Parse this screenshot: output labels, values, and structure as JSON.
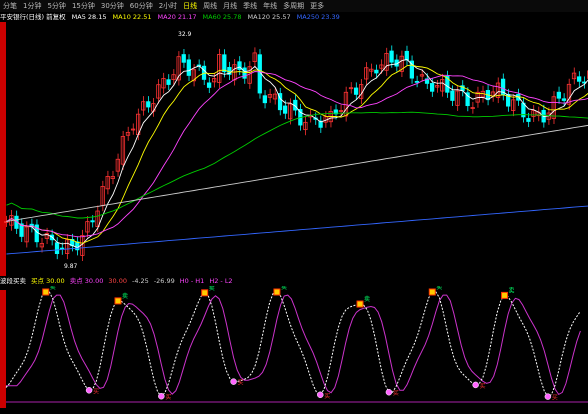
{
  "toolbar": {
    "tabs": [
      "分笔",
      "1分钟",
      "5分钟",
      "15分钟",
      "30分钟",
      "60分钟",
      "2小时",
      "日线",
      "周线",
      "月线",
      "季线",
      "年线",
      "多周期",
      "更多"
    ],
    "active": 7
  },
  "main_header": {
    "title": "平安银行(日线) 前复权",
    "ma": [
      {
        "label": "MA5 28.15",
        "color": "#ffffff"
      },
      {
        "label": "MA10 22.51",
        "color": "#ffff00"
      },
      {
        "label": "MA20 21.17",
        "color": "#ff44ff"
      },
      {
        "label": "MA60 25.78",
        "color": "#00cc00"
      },
      {
        "label": "MA120 25.57",
        "color": "#cccccc"
      },
      {
        "label": "MA250 23.39",
        "color": "#3366ff"
      }
    ]
  },
  "annotations": {
    "high": "32.9",
    "low": "9.87"
  },
  "indicator_header": {
    "name": "波段买卖",
    "items": [
      {
        "label": "买点 30.00",
        "color": "#ffff00"
      },
      {
        "label": "卖点 30.00",
        "color": "#ff44ff"
      },
      {
        "label": "30.00",
        "color": "#ff4444"
      },
      {
        "label": "-4.25",
        "color": "#cccccc"
      },
      {
        "label": "-26.99",
        "color": "#cccccc"
      },
      {
        "label": "H0 - H1",
        "color": "#ff44ff"
      },
      {
        "label": "H2 - L2",
        "color": "#ff44ff"
      }
    ]
  },
  "signals": {
    "buy": "买",
    "sell": "卖"
  },
  "colors": {
    "up": "#ff3333",
    "down": "#00ffff",
    "ma5": "#ffffff",
    "ma10": "#ffff00",
    "ma20": "#ff44ff",
    "ma60": "#00cc00",
    "ma120": "#cccccc",
    "ma250": "#3366ff"
  }
}
